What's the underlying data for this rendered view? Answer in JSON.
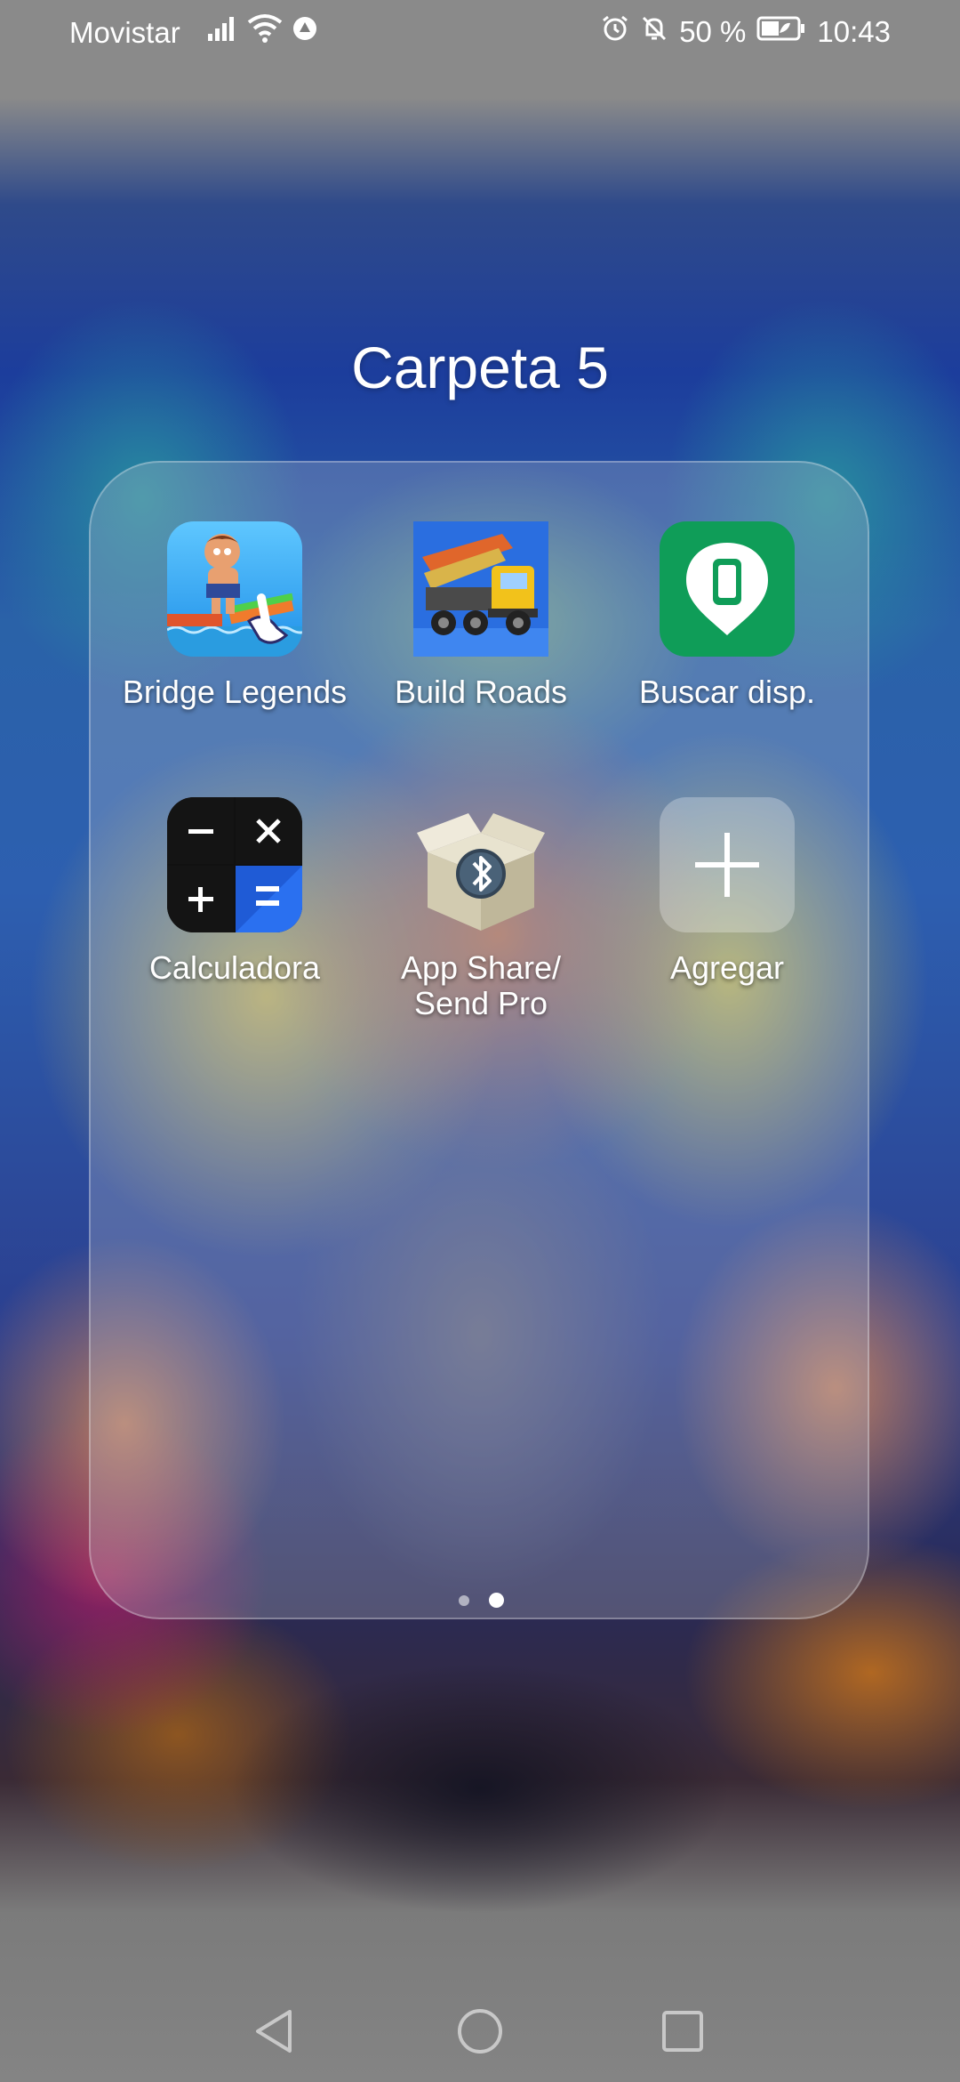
{
  "status_bar": {
    "carrier": "Movistar",
    "battery_percent": "50 %",
    "time": "10:43",
    "icons": [
      "signal-icon",
      "wifi-icon",
      "data-saver-icon",
      "alarm-icon",
      "bell-off-icon",
      "battery-icon"
    ]
  },
  "folder": {
    "title": "Carpeta 5",
    "apps": [
      {
        "label": "Bridge Legends",
        "icon": "bridge-legends-icon"
      },
      {
        "label": "Build Roads",
        "icon": "build-roads-icon"
      },
      {
        "label": "Buscar disp.",
        "icon": "find-device-icon"
      },
      {
        "label": "Calculadora",
        "icon": "calculator-icon"
      },
      {
        "label": "App Share/\nSend Pro",
        "icon": "app-share-icon"
      },
      {
        "label": "Agregar",
        "icon": "add-icon"
      }
    ],
    "page_indicator": {
      "pages": 2,
      "current": 2
    }
  },
  "nav_bar": {
    "buttons": [
      "back-button",
      "home-button",
      "recents-button"
    ]
  },
  "colors": {
    "find_device_green": "#0f9d58",
    "calculator_blue": "#1f5bd6"
  }
}
